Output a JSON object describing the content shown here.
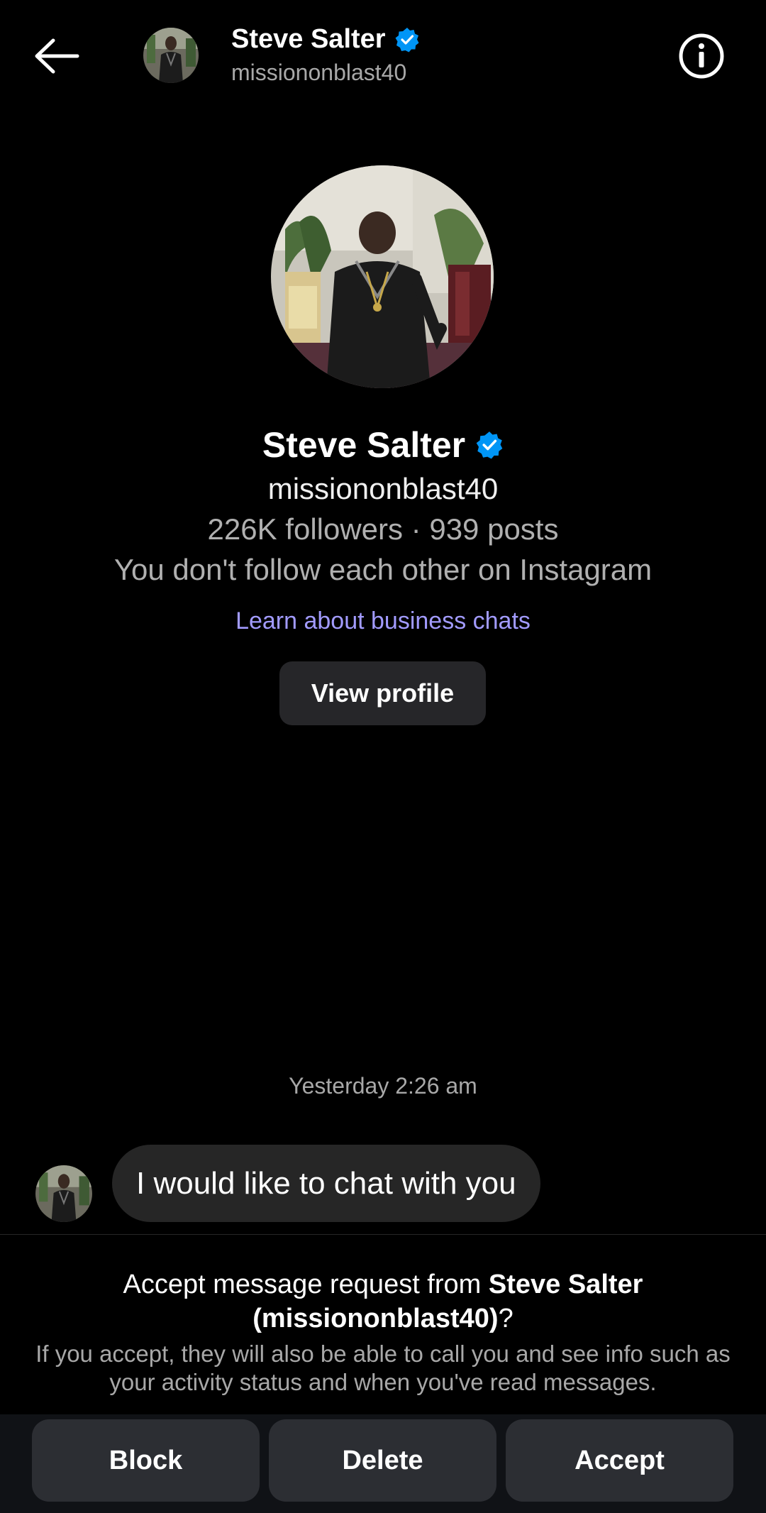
{
  "header": {
    "back_icon": "arrow-left-icon",
    "name": "Steve Salter",
    "username": "missiononblast40",
    "verified_icon": "verified-badge-icon",
    "info_icon": "info-icon"
  },
  "profile": {
    "name": "Steve Salter",
    "username": "missiononblast40",
    "stats": "226K followers · 939 posts",
    "follow_status": "You don't follow each other on Instagram",
    "learn_link": "Learn about business chats",
    "view_profile_label": "View profile"
  },
  "conversation": {
    "timestamp": "Yesterday 2:26 am",
    "messages": [
      {
        "text": "I would like to chat with you"
      }
    ]
  },
  "request": {
    "title_prefix": "Accept message request from ",
    "title_name": "Steve Salter",
    "title_username": "(missiononblast40)",
    "title_suffix": "?",
    "description": "If you accept, they will also be able to call you and see info such as your activity status and when you've read messages."
  },
  "actions": {
    "block_label": "Block",
    "delete_label": "Delete",
    "accept_label": "Accept"
  },
  "colors": {
    "background": "#000000",
    "verified_blue": "#0095f6",
    "link_purple": "#a29bff",
    "button_bg": "#2c2e33",
    "bubble_bg": "#262626"
  }
}
